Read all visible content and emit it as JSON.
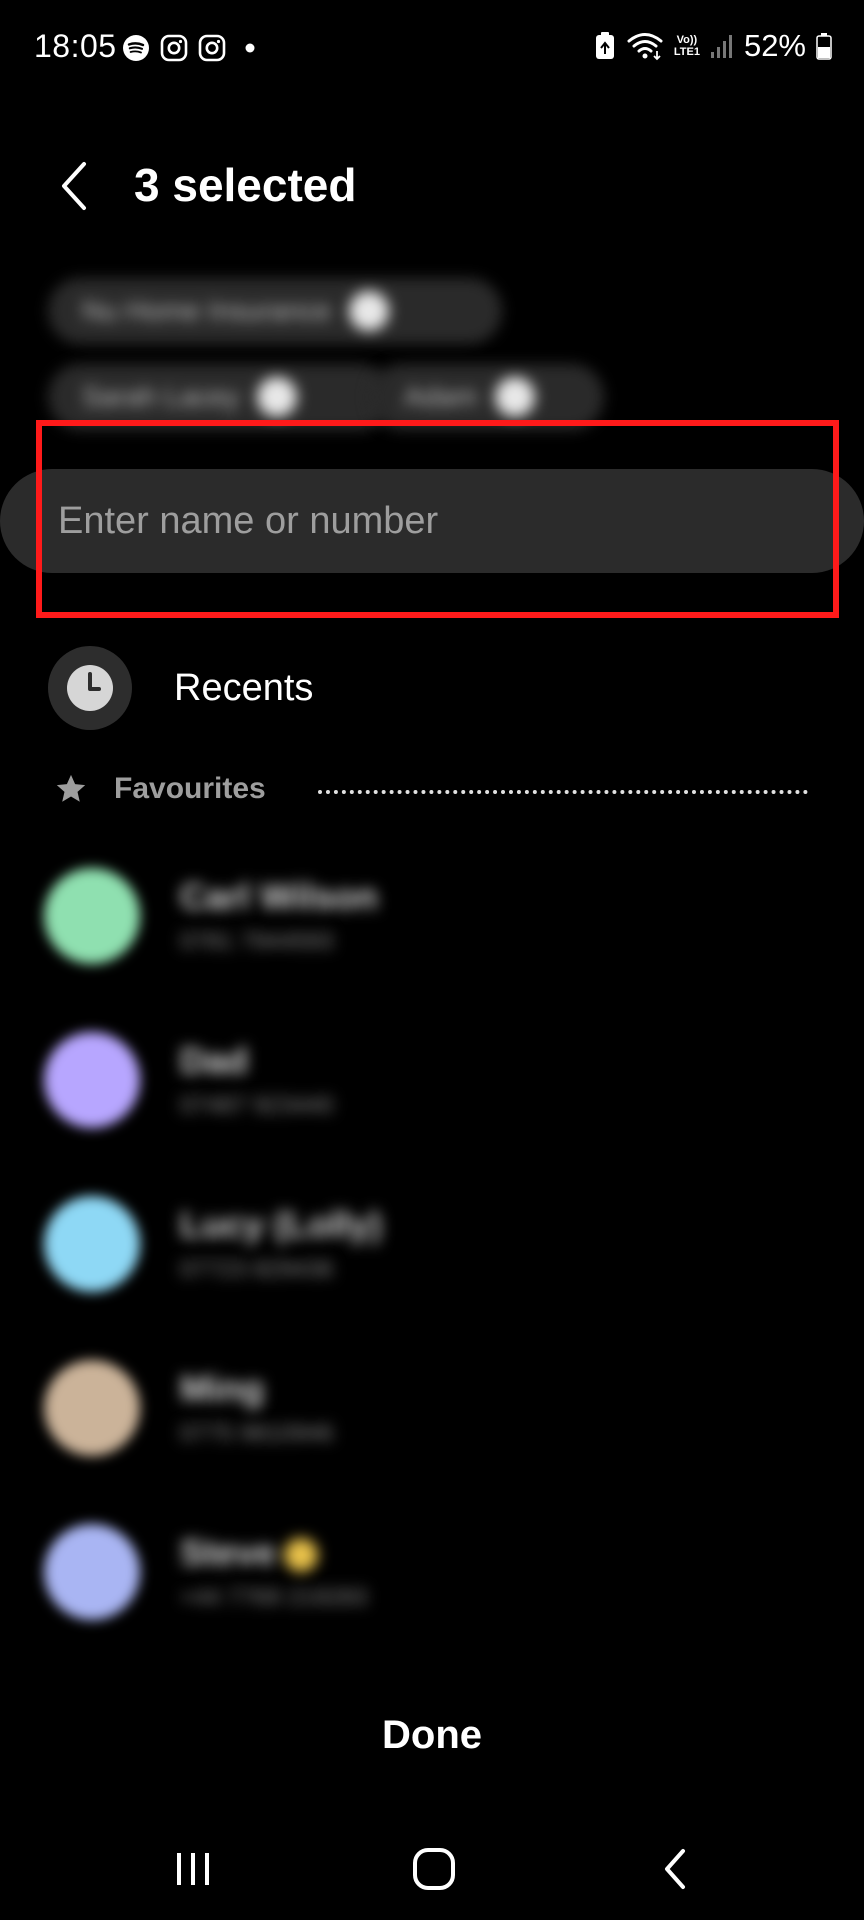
{
  "status_bar": {
    "time": "18:05",
    "left_icons": [
      "spotify-icon",
      "instagram-icon",
      "instagram-icon",
      "notification-dot-icon"
    ],
    "lte_top": "Vo))",
    "lte_bottom": "LTE1",
    "battery_percent": "52%"
  },
  "header": {
    "title": "3 selected"
  },
  "selected_chips": [
    {
      "label": "Nu Home Insurance"
    },
    {
      "label": "Sarah Lacey"
    },
    {
      "label": "Adam"
    }
  ],
  "search": {
    "placeholder": "Enter name or number",
    "value": ""
  },
  "recents": {
    "label": "Recents"
  },
  "favourites": {
    "label": "Favourites",
    "contacts": [
      {
        "name": "Carl Wilson",
        "sub": "0781 7944593",
        "avatar_color": "#8fe0b0"
      },
      {
        "name": "Dad",
        "sub": "07487 923440",
        "avatar_color": "#b7a6ff"
      },
      {
        "name": "Lucy (Lolly)",
        "sub": "07723 829436",
        "avatar_color": "#8ed8f5"
      },
      {
        "name": "Ming",
        "sub": "0775 9810946",
        "avatar_color": "#cbb399"
      },
      {
        "name": "Steve",
        "sub": "+44 7769 219283",
        "avatar_color": "#a9b5f3"
      }
    ]
  },
  "footer": {
    "done_label": "Done"
  },
  "nav": {
    "items": [
      "recent-apps-icon",
      "home-icon",
      "back-icon"
    ]
  },
  "colors": {
    "background": "#000000",
    "highlight": "#ff1a1a",
    "search_bg": "#2b2b2b"
  }
}
